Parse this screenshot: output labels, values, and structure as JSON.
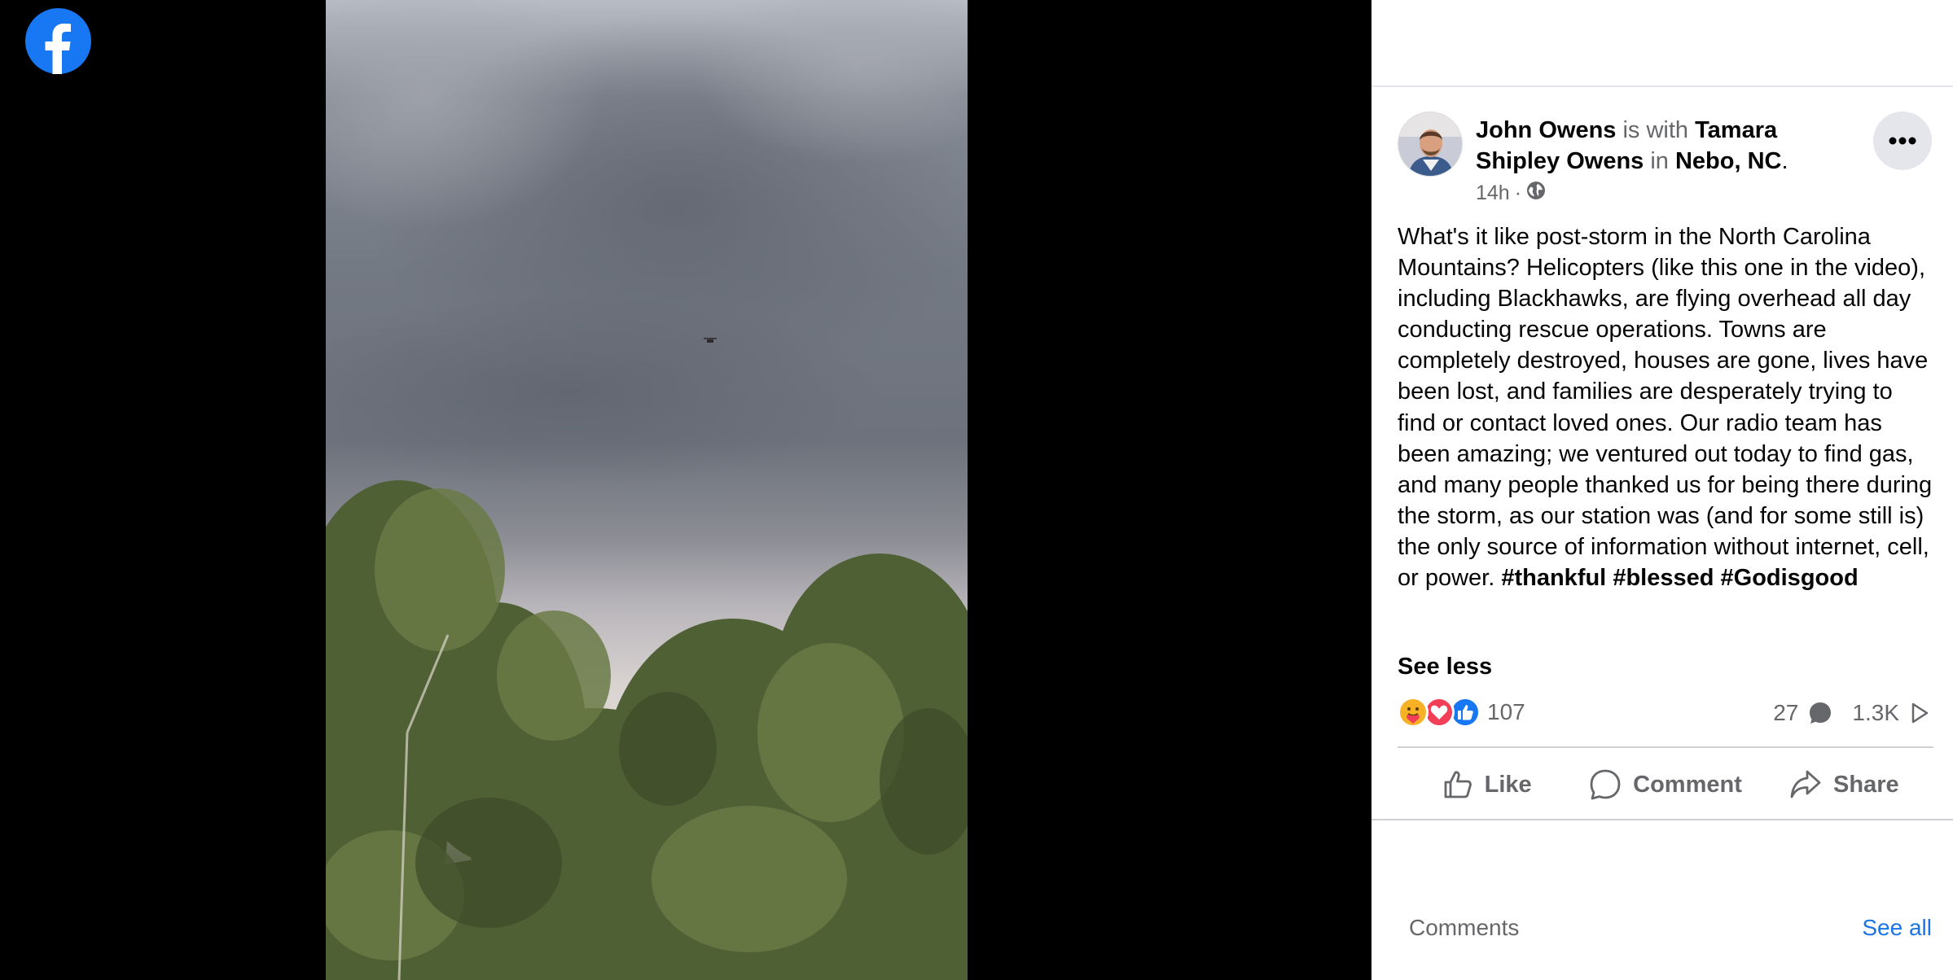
{
  "post": {
    "author": "John Owens",
    "with_text": " is with ",
    "tagged": "Tamara Shipley Owens",
    "in_text": " in ",
    "location": "Nebo, NC",
    "period": ".",
    "time": "14h",
    "dot": "·",
    "privacy_icon": "globe-icon",
    "body_text": "What's it like post-storm in the North Carolina Mountains? Helicopters (like this one in the video), including Blackhawks, are flying overhead all day conducting rescue operations. Towns are completely destroyed, houses are gone, lives have been lost, and families are desperately trying to find or contact loved ones. Our radio team has been amazing; we ventured out today to find gas, and many people thanked us for being there during the storm, as our station was (and for some still is) the only source of information without internet, cell, or power. ",
    "hashtags": [
      "#thankful",
      "#blessed",
      "#Godisgood"
    ],
    "see_less": "See less"
  },
  "stats": {
    "reactions_count": "107",
    "comments_count": "27",
    "views_count": "1.3K"
  },
  "actions": {
    "like": "Like",
    "comment": "Comment",
    "share": "Share"
  },
  "comments_section": {
    "label": "Comments",
    "see_all": "See all"
  },
  "colors": {
    "brand": "#1877f2",
    "link": "#1b74e4",
    "love": "#f33e58",
    "care": "#f7b125"
  }
}
